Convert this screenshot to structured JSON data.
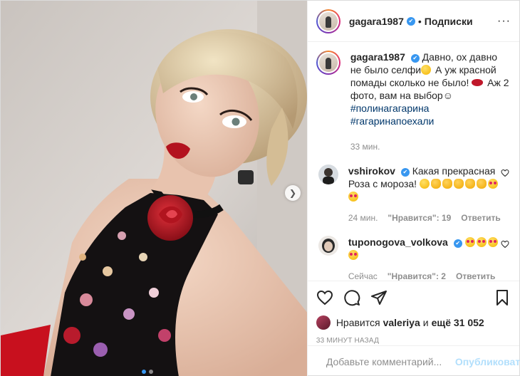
{
  "header": {
    "username": "gagara1987",
    "verified": "✔",
    "separator": "•",
    "follow_label": "Подписки",
    "more_label": "···"
  },
  "caption": {
    "username": "gagara1987",
    "text_1": "Давно, ох давно не было селфи",
    "text_2": " А уж красной помады сколько не было! ",
    "text_3": " Аж 2 фото, вам на выбор",
    "text_smile": "☺",
    "hashtag_1": "#полинагагарина",
    "hashtag_2": "#гагаринапоехали",
    "time": "33 мин."
  },
  "comments": [
    {
      "username": "vshirokov",
      "text": "Какая прекрасная Роза с мороза!",
      "time": "24 мин.",
      "likes": "\"Нравится\": 19",
      "reply": "Ответить"
    },
    {
      "username": "tuponogova_volkova",
      "text": "",
      "time": "Сейчас",
      "likes": "\"Нравится\": 2",
      "reply": "Ответить"
    }
  ],
  "likes_line": {
    "prefix": "Нравится",
    "user": "valeriya",
    "and": "и",
    "others": "ещё 31 052"
  },
  "timeago": "33 МИНУТ НАЗАД",
  "add_comment": {
    "placeholder": "Добавьте комментарий...",
    "publish_label": "Опубликовать"
  },
  "icons": {
    "like": "heart-icon",
    "comment": "comment-icon",
    "share": "share-icon",
    "save": "bookmark-icon",
    "next": "chevron-right-icon",
    "emoji": "smiley-icon"
  },
  "colors": {
    "verified": "#3897f0",
    "link": "#00376b",
    "muted": "#8e8e8e",
    "publish": "#b2dffc"
  },
  "carousel": {
    "slides": 2,
    "active": 1
  }
}
